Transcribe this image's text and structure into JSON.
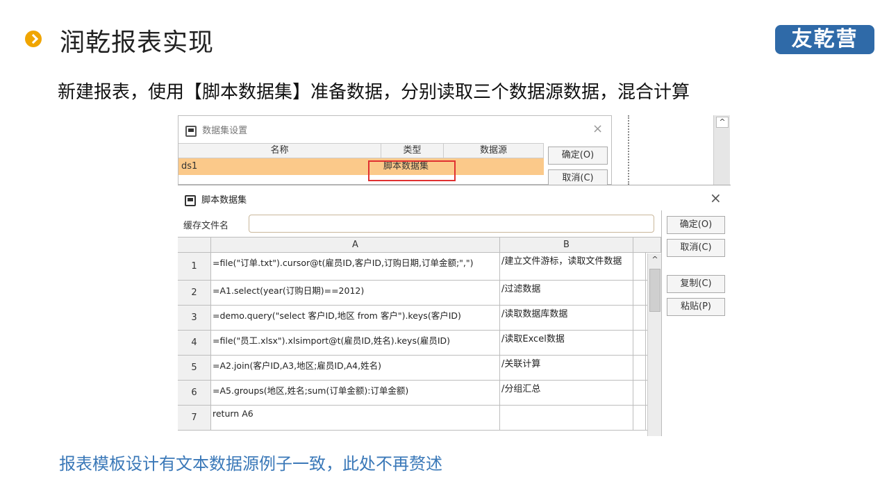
{
  "slide": {
    "title": "润乾报表实现",
    "logo_text": "友乾营",
    "subtitle": "新建报表，使用【脚本数据集】准备数据，分别读取三个数据源数据，混合计算",
    "footer_note": "报表模板设计有文本数据源例子一致，此处不再赘述",
    "accent_color": "#f0a500",
    "link_color": "#3a78b8"
  },
  "dataset_dialog": {
    "title": "数据集设置",
    "columns": [
      "名称",
      "类型",
      "数据源"
    ],
    "row": {
      "name": "ds1",
      "type": "脚本数据集",
      "source": ""
    },
    "ok_label": "确定(O)",
    "cancel_label": "取消(C)",
    "highlight_color": "#fbc98a"
  },
  "script_dialog": {
    "title": "脚本数据集",
    "cache_label": "缓存文件名",
    "cache_value": "",
    "ok_label": "确定(O)",
    "cancel_label": "取消(C)",
    "copy_label": "复制(C)",
    "paste_label": "粘贴(P)",
    "grid": {
      "columns": [
        "A",
        "B"
      ],
      "rows": [
        {
          "num": "1",
          "a": "=file(\"订单.txt\").cursor@t(雇员ID,客户ID,订购日期,订单金额;\",\")",
          "b": "/建立文件游标，读取文件数据"
        },
        {
          "num": "2",
          "a": "=A1.select(year(订购日期)==2012)",
          "b": "/过滤数据"
        },
        {
          "num": "3",
          "a": "=demo.query(\"select 客户ID,地区 from 客户\").keys(客户ID)",
          "b": "/读取数据库数据"
        },
        {
          "num": "4",
          "a": "=file(\"员工.xlsx\").xlsimport@t(雇员ID,姓名).keys(雇员ID)",
          "b": "/读取Excel数据"
        },
        {
          "num": "5",
          "a": "=A2.join(客户ID,A3,地区;雇员ID,A4,姓名)",
          "b": "/关联计算"
        },
        {
          "num": "6",
          "a": "=A5.groups(地区,姓名;sum(订单金额):订单金额)",
          "b": "/分组汇总"
        },
        {
          "num": "7",
          "a": "return A6",
          "b": ""
        }
      ]
    }
  }
}
